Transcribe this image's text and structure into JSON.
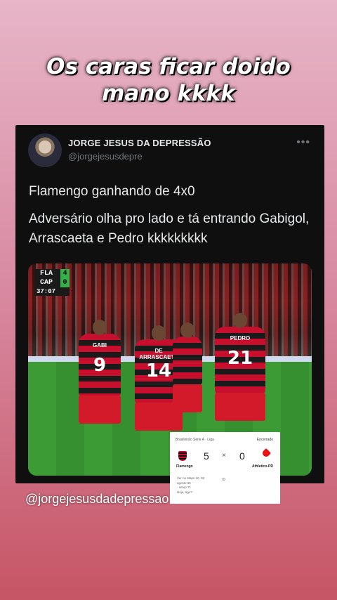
{
  "story": {
    "caption_line1": "Os caras ficar doido",
    "caption_line2": "mano kkkk",
    "credit": "@jorgejesusdadepressao"
  },
  "tweet": {
    "author_name": "JORGE JESUS DA DEPRESSÃO",
    "author_handle": "@jorgejesusdepre",
    "more_icon": "•••",
    "text_line1": "Flamengo ganhando de 4x0",
    "text_line2": "Adversário olha pro lado e tá entrando Gabigol, Arrascaeta e Pedro kkkkkkkkk",
    "photo": {
      "scorebug": {
        "home_team": "FLA",
        "home_score": "4",
        "away_team": "CAP",
        "away_score": "0",
        "time": "37:07"
      },
      "players": [
        {
          "name": "GABI",
          "number": "9"
        },
        {
          "name": "DE ARRASCAETA",
          "number": "14"
        },
        {
          "name": "PEDRO",
          "number": "21"
        }
      ]
    }
  },
  "result_card": {
    "competition": "Brasileirão Série A · Liga",
    "status": "Encerrado",
    "home_team": "Flamengo",
    "home_score": "5",
    "separator": "×",
    "away_score": "0",
    "away_team": "Athletico-PR",
    "info_line1": "Ver no Maps 10, 08",
    "info_line2": "agosto 65",
    "info_line3": "· setup 71",
    "info_line4": "Hoje, ago?"
  }
}
